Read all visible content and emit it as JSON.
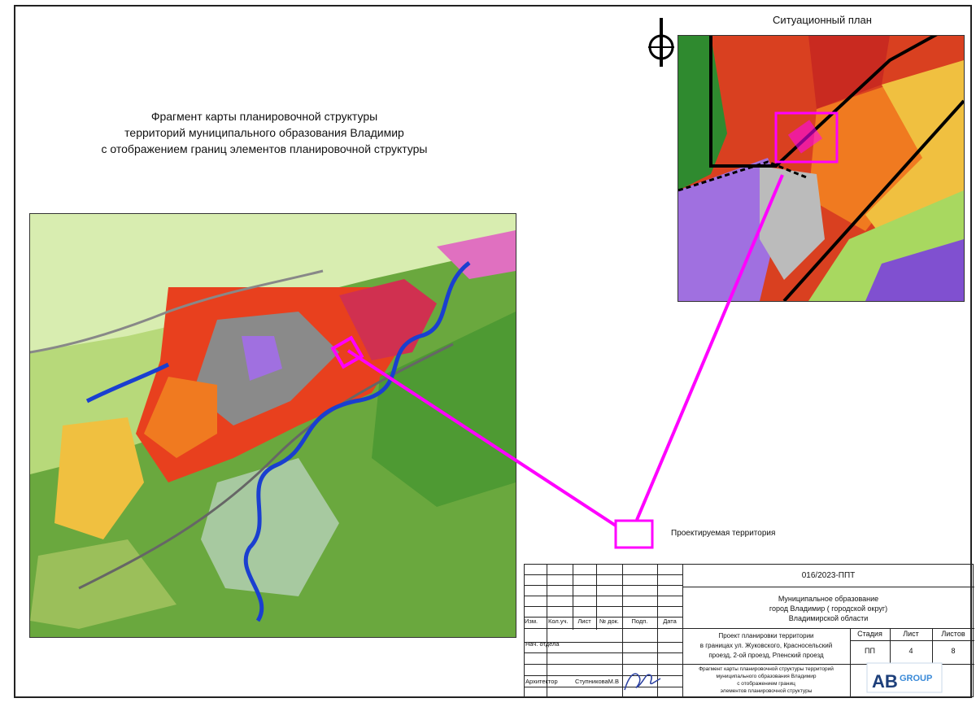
{
  "title": {
    "line1": "Фрагмент карты планировочной структуры",
    "line2": "территорий муниципального образования Владимир",
    "line3": "с отображением границ элементов планировочной структуры"
  },
  "situation_plan": {
    "title": "Ситуационный план"
  },
  "project_area_label": "Проектируемая территория",
  "colors": {
    "connector": "#ff00ff",
    "residential": "#e8401e",
    "industrial": "#8a8a8a",
    "forest": "#5aa33a",
    "meadow": "#c8e68a",
    "water": "#1a3fd0",
    "public": "#a070e0"
  },
  "icons": {
    "north_arrow": "north-arrow-icon",
    "logo": "abgroup-logo"
  },
  "stamp": {
    "doc_code": "016/2023-ППТ",
    "org_line1": "Муниципальное образование",
    "org_line2": "город Владимир ( городской округ)",
    "org_line3": "Владимирской области",
    "headers": [
      "Изм.",
      "Кол.уч.",
      "Лист",
      "№ док.",
      "Подп.",
      "Дата"
    ],
    "role_dept": "Нач. отдела",
    "role_arch": "Архитектор",
    "arch_name": "СтупниковаМ.В",
    "project_line1": "Проект планировки территории",
    "project_line2": "в границах ул. Жуковского, Красносельский",
    "project_line3": "проезд, 2-ой проезд, Рпенский проезд",
    "stage_label": "Стадия",
    "sheet_label": "Лист",
    "sheets_label": "Листов",
    "stage_value": "ПП",
    "sheet_value": "4",
    "sheets_value": "8",
    "sheet_title_line1": "Фрагмент карты планировочной структуры территорий",
    "sheet_title_line2": "муниципального образования Владимир",
    "sheet_title_line3": "с отображением границ",
    "sheet_title_line4": "элементов планировочной структуры",
    "logo_text_a": "AB",
    "logo_text_b": "GROUP"
  }
}
